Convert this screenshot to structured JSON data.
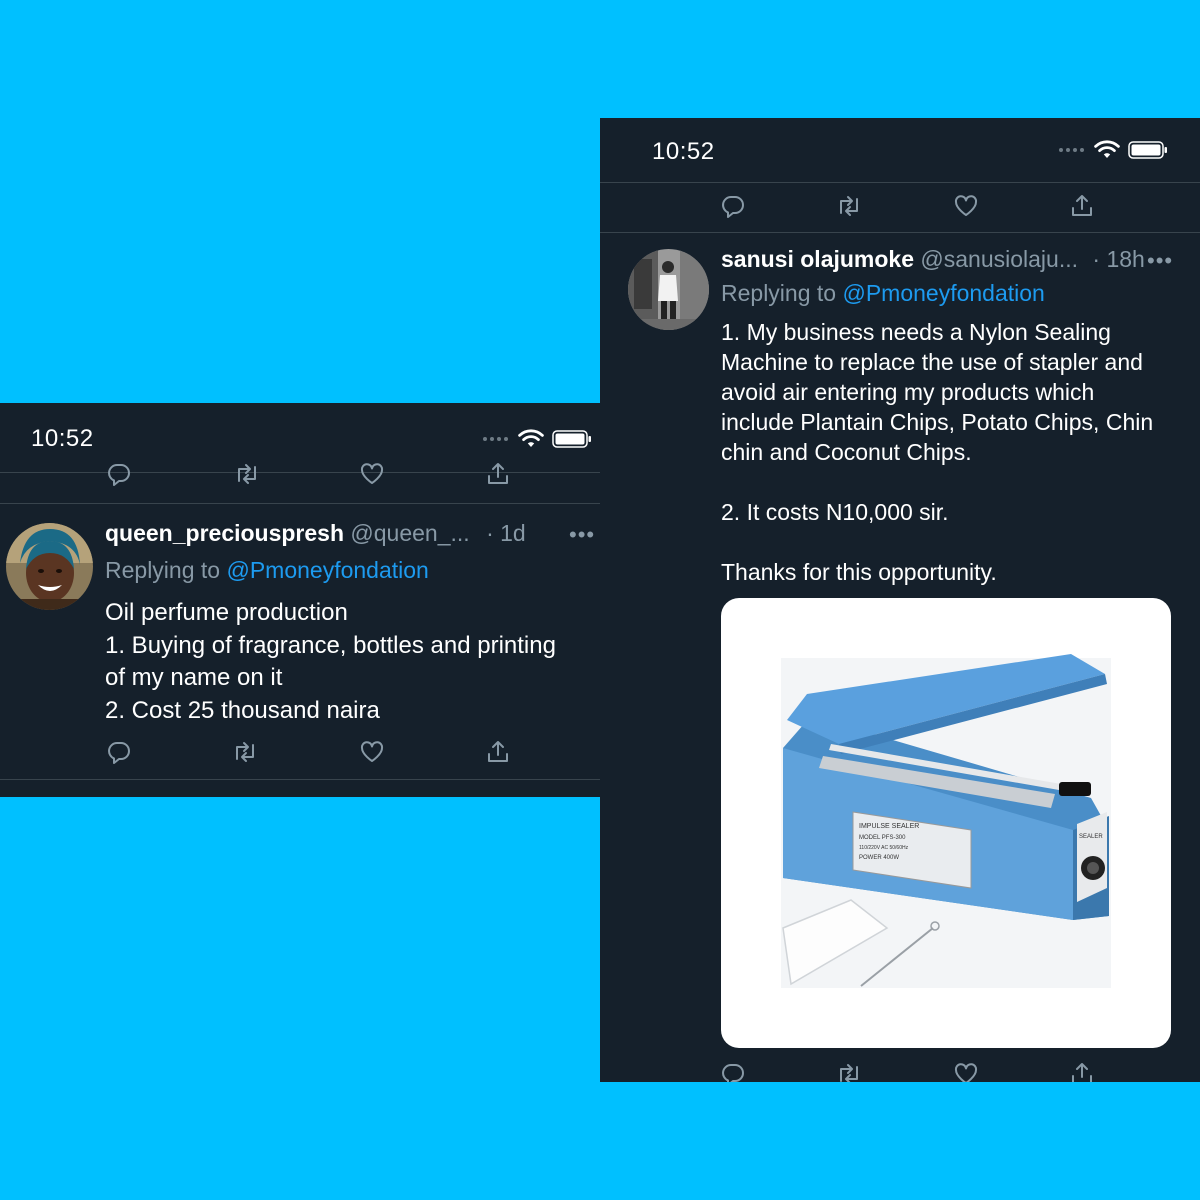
{
  "background_color": "#00c0ff",
  "left_screenshot": {
    "status_time": "10:52",
    "tweet": {
      "display_name": "queen_preciouspresh",
      "handle": "@queen_...",
      "time": "· 1d",
      "more": "•••",
      "replying_label": "Replying to",
      "replying_to": "@Pmoneyfondation",
      "lines": [
        "Oil perfume production",
        "1. Buying of fragrance, bottles and printing",
        "of my name on it",
        "2. Cost 25 thousand naira"
      ]
    }
  },
  "right_screenshot": {
    "status_time": "10:52",
    "tweet": {
      "display_name": "sanusi olajumoke",
      "handle": "@sanusiolaju...",
      "time": "· 18h",
      "more": "•••",
      "replying_label": "Replying to",
      "replying_to": "@Pmoneyfondation",
      "lines": [
        "1. My business needs a Nylon Sealing",
        "Machine to replace the use of stapler and",
        "avoid air entering my products which",
        "include Plantain Chips, Potato Chips, Chin",
        "chin and Coconut Chips.",
        "",
        "2. It costs N10,000 sir.",
        "",
        "Thanks for this opportunity."
      ],
      "media": {
        "label_lines": [
          "IMPULSE SEALER",
          "MODEL PFS-300",
          "110/220V AC 50/60Hz",
          "POWER 400W"
        ],
        "side_label": "SEALER"
      }
    }
  },
  "icons": [
    "reply-icon",
    "retweet-icon",
    "like-icon",
    "share-icon",
    "signal-icon",
    "wifi-icon",
    "battery-icon"
  ],
  "colors": {
    "panel": "#15202b",
    "divider": "#38444d",
    "muted": "#8899a6",
    "link": "#1d9bf0"
  }
}
